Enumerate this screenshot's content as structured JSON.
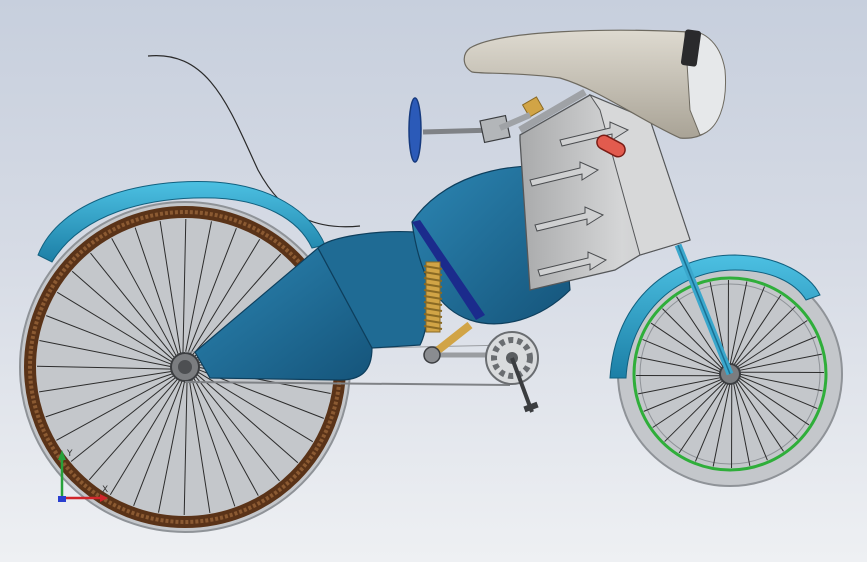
{
  "viewport": {
    "background_top": "#c7cfdd",
    "background_bottom": "#eef0f3"
  },
  "model": {
    "colors": {
      "fender_teal": "#2a9fc4",
      "body_blue": "#1f6b94",
      "body_dark": "#15547a",
      "panel_gray": "#c9cacb",
      "seat_beige": "#c8c2b4",
      "spring_gold": "#d1a446",
      "rim_wood": "#6b3d1f",
      "rim_green": "#2fae3a",
      "tire_gray": "#b9bcc0"
    }
  },
  "triad": {
    "x_label": "X",
    "y_label": "Y",
    "x_color": "#d1262b",
    "y_color": "#27a13a",
    "z_color": "#2a3fd0"
  }
}
